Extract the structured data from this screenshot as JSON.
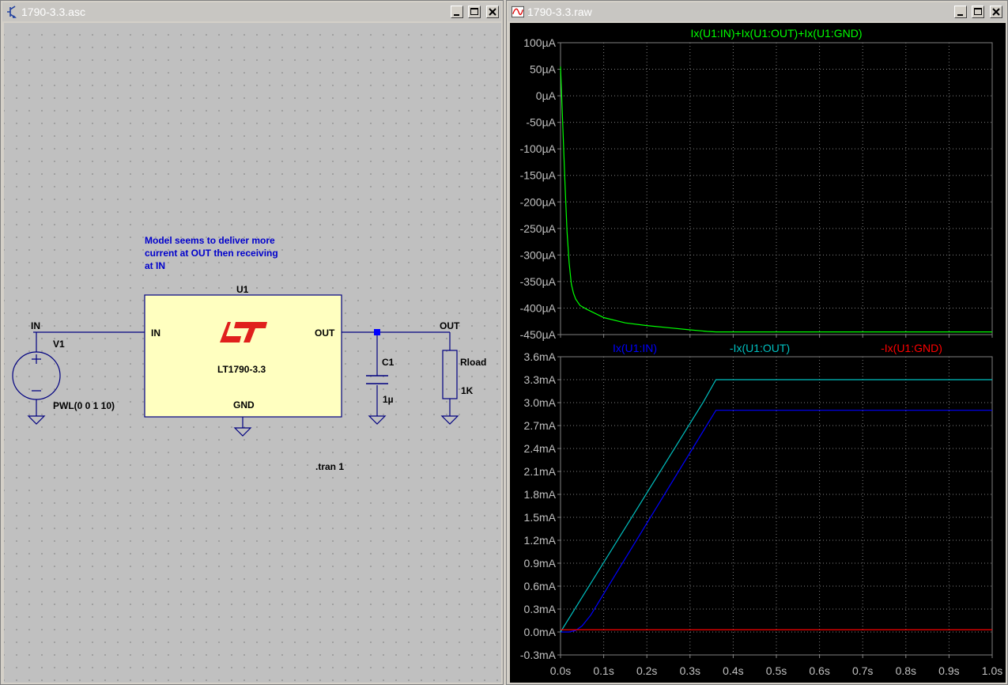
{
  "schematic_window": {
    "title": "1790-3.3.asc",
    "buttons": [
      "minimize-icon",
      "maximize-icon",
      "close-icon"
    ],
    "comment_lines": [
      "Model seems to deliver more",
      "current at OUT then receiving",
      "at IN"
    ],
    "directive": ".tran 1",
    "u1": {
      "ref": "U1",
      "part": "LT1790-3.3",
      "pin_in": "IN",
      "pin_out": "OUT",
      "pin_gnd": "GND"
    },
    "v1": {
      "ref": "V1",
      "value": "PWL(0 0 1 10)"
    },
    "c1": {
      "ref": "C1",
      "value": "1µ"
    },
    "rload": {
      "ref": "Rload",
      "value": "1K"
    },
    "net_in": "IN",
    "net_out": "OUT"
  },
  "waveform_window": {
    "title": "1790-3.3.raw",
    "buttons": [
      "minimize-icon",
      "maximize-icon",
      "close-icon"
    ]
  },
  "colors": {
    "green_trace": "#00ff00",
    "blue_trace": "#0000ff",
    "cyan_trace": "#00c0c0",
    "red_trace": "#ff0000",
    "wire": "#000080",
    "component_fill": "#ffffc0",
    "lt_logo": "#e0201c"
  },
  "chart_data": [
    {
      "type": "line",
      "title": "Ix(U1:IN)+Ix(U1:OUT)+Ix(U1:GND)",
      "yticks": [
        "100µA",
        "50µA",
        "0µA",
        "-50µA",
        "-100µA",
        "-150µA",
        "-200µA",
        "-250µA",
        "-300µA",
        "-350µA",
        "-400µA",
        "-450µA"
      ],
      "ylim": [
        -450,
        100
      ],
      "xlim": [
        0,
        1.0
      ],
      "series": [
        {
          "name": "Ix(U1:IN)+Ix(U1:OUT)+Ix(U1:GND)",
          "color": "#00ff00",
          "x": [
            0,
            0.005,
            0.01,
            0.015,
            0.02,
            0.025,
            0.03,
            0.035,
            0.045,
            0.06,
            0.08,
            0.1,
            0.15,
            0.2,
            0.25,
            0.3,
            0.34,
            0.36,
            1.0
          ],
          "y": [
            55,
            -50,
            -160,
            -255,
            -315,
            -355,
            -372,
            -383,
            -395,
            -402,
            -410,
            -418,
            -428,
            -433,
            -437,
            -441,
            -444,
            -445,
            -445
          ]
        }
      ]
    },
    {
      "type": "line",
      "yticks": [
        "3.6mA",
        "3.3mA",
        "3.0mA",
        "2.7mA",
        "2.4mA",
        "2.1mA",
        "1.8mA",
        "1.5mA",
        "1.2mA",
        "0.9mA",
        "0.6mA",
        "0.3mA",
        "0.0mA",
        "-0.3mA"
      ],
      "xticks": [
        "0.0s",
        "0.1s",
        "0.2s",
        "0.3s",
        "0.4s",
        "0.5s",
        "0.6s",
        "0.7s",
        "0.8s",
        "0.9s",
        "1.0s"
      ],
      "ylim": [
        -0.3,
        3.6
      ],
      "xlim": [
        0,
        1.0
      ],
      "series": [
        {
          "name": "Ix(U1:IN)",
          "color": "#0000ff",
          "x": [
            0,
            0.02,
            0.035,
            0.05,
            0.07,
            0.1,
            0.36,
            1.0
          ],
          "y": [
            0,
            0,
            0.02,
            0.08,
            0.22,
            0.5,
            2.9,
            2.9
          ]
        },
        {
          "name": "-Ix(U1:OUT)",
          "color": "#00c0c0",
          "x": [
            0,
            0.33,
            0.36,
            1.0
          ],
          "y": [
            0,
            3.0,
            3.3,
            3.3
          ]
        },
        {
          "name": "-Ix(U1:GND)",
          "color": "#ff0000",
          "x": [
            0,
            1.0
          ],
          "y": [
            0.03,
            0.03
          ]
        }
      ]
    }
  ]
}
